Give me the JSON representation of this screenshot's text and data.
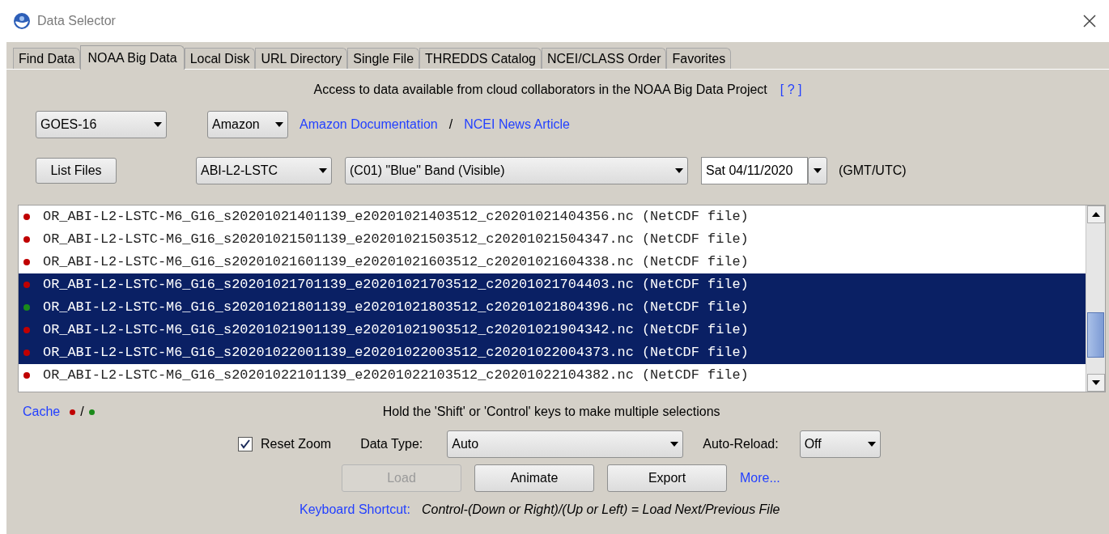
{
  "window": {
    "title": "Data Selector"
  },
  "tabs": [
    {
      "label": "Find Data",
      "selected": false
    },
    {
      "label": "NOAA Big Data",
      "selected": true
    },
    {
      "label": "Local Disk",
      "selected": false
    },
    {
      "label": "URL Directory",
      "selected": false
    },
    {
      "label": "Single File",
      "selected": false
    },
    {
      "label": "THREDDS Catalog",
      "selected": false
    },
    {
      "label": "NCEI/CLASS Order",
      "selected": false
    },
    {
      "label": "Favorites",
      "selected": false
    }
  ],
  "intro": {
    "text": "Access to data available from cloud collaborators in the NOAA Big Data Project",
    "help_link": "[ ? ]"
  },
  "satellite": "GOES-16",
  "provider": "Amazon",
  "links": [
    "Amazon Documentation",
    "NCEI News Article"
  ],
  "link_separator": "/",
  "list_files_button": "List Files",
  "product": "ABI-L2-LSTC",
  "band": "(C01) \"Blue\" Band (Visible)",
  "date": "Sat 04/11/2020",
  "timezone": "(GMT/UTC)",
  "files": [
    {
      "name": "OR_ABI-L2-LSTC-M6_G16_s20201021401139_e20201021403512_c20201021404356.nc (NetCDF file)",
      "selected": false,
      "color": "#c00000"
    },
    {
      "name": "OR_ABI-L2-LSTC-M6_G16_s20201021501139_e20201021503512_c20201021504347.nc (NetCDF file)",
      "selected": false,
      "color": "#c00000"
    },
    {
      "name": "OR_ABI-L2-LSTC-M6_G16_s20201021601139_e20201021603512_c20201021604338.nc (NetCDF file)",
      "selected": false,
      "color": "#c00000"
    },
    {
      "name": "OR_ABI-L2-LSTC-M6_G16_s20201021701139_e20201021703512_c20201021704403.nc (NetCDF file)",
      "selected": true,
      "color": "#c00000"
    },
    {
      "name": "OR_ABI-L2-LSTC-M6_G16_s20201021801139_e20201021803512_c20201021804396.nc (NetCDF file)",
      "selected": true,
      "color": "#1a8a1a"
    },
    {
      "name": "OR_ABI-L2-LSTC-M6_G16_s20201021901139_e20201021903512_c20201021904342.nc (NetCDF file)",
      "selected": true,
      "color": "#c00000"
    },
    {
      "name": "OR_ABI-L2-LSTC-M6_G16_s20201022001139_e20201022003512_c20201022004373.nc (NetCDF file)",
      "selected": true,
      "color": "#c00000"
    },
    {
      "name": "OR_ABI-L2-LSTC-M6_G16_s20201022101139_e20201022103512_c20201022104382.nc (NetCDF file)",
      "selected": false,
      "color": "#c00000"
    }
  ],
  "cache": {
    "label": "Cache",
    "separator": "/",
    "legend": [
      {
        "color": "#c00000"
      },
      {
        "color": "#1a8a1a"
      }
    ]
  },
  "hint": "Hold the 'Shift' or 'Control' keys to make multiple selections",
  "reset_zoom": {
    "label": "Reset Zoom",
    "checked": true
  },
  "data_type": {
    "label": "Data Type:",
    "value": "Auto"
  },
  "auto_reload": {
    "label": "Auto-Reload:",
    "value": "Off"
  },
  "buttons": [
    {
      "label": "Load",
      "disabled": true
    },
    {
      "label": "Animate",
      "disabled": false
    },
    {
      "label": "Export",
      "disabled": false
    }
  ],
  "more_link": "More...",
  "shortcut": {
    "label": "Keyboard Shortcut:",
    "text": "Control-(Down or Right)/(Up or Left) = Load Next/Previous File"
  }
}
